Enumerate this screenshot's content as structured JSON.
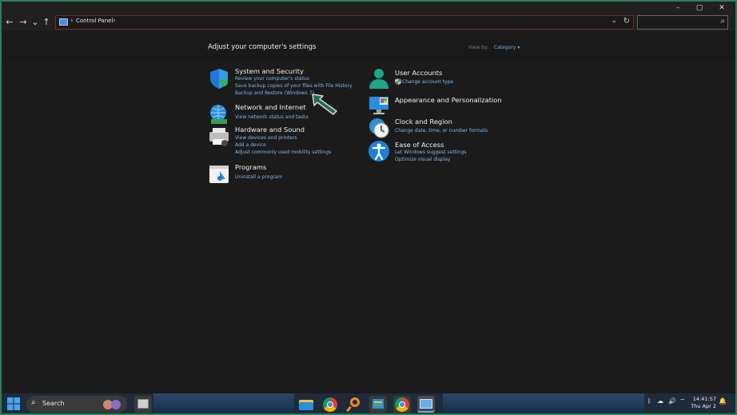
{
  "window": {
    "minimize_glyph": "–",
    "maximize_glyph": "▢",
    "close_glyph": "✕"
  },
  "address_bar": {
    "crumb": "Control Panel",
    "separator": "›"
  },
  "header": {
    "title": "Adjust your computer's settings",
    "view_by_label": "View by:",
    "view_by_value": "Category ▾"
  },
  "categories_left": [
    {
      "title": "System and Security",
      "links": [
        "Review your computer's status",
        "Save backup copies of your files with File History",
        "Backup and Restore (Windows 7)"
      ],
      "icon": "shield-icon"
    },
    {
      "title": "Network and Internet",
      "links": [
        "View network status and tasks"
      ],
      "icon": "network-globe-icon"
    },
    {
      "title": "Hardware and Sound",
      "links": [
        "View devices and printers",
        "Add a device",
        "Adjust commonly used mobility settings"
      ],
      "icon": "printer-icon"
    },
    {
      "title": "Programs",
      "links": [
        "Uninstall a program"
      ],
      "icon": "programs-icon"
    }
  ],
  "categories_right": [
    {
      "title": "User Accounts",
      "links": [
        "Change account type"
      ],
      "icon": "user-icon"
    },
    {
      "title": "Appearance and Personalization",
      "links": [],
      "icon": "monitor-icon"
    },
    {
      "title": "Clock and Region",
      "links": [
        "Change date, time, or number formats"
      ],
      "icon": "clock-globe-icon"
    },
    {
      "title": "Ease of Access",
      "links": [
        "Let Windows suggest settings",
        "Optimize visual display"
      ],
      "icon": "accessibility-icon"
    }
  ],
  "taskbar": {
    "search_label": "Search",
    "time": "14:41:57",
    "date": "Thu Apr 2"
  },
  "colors": {
    "link": "#7fb7ec",
    "accent_border": "#2f7d5b",
    "arrow": "#1f6b4e"
  }
}
